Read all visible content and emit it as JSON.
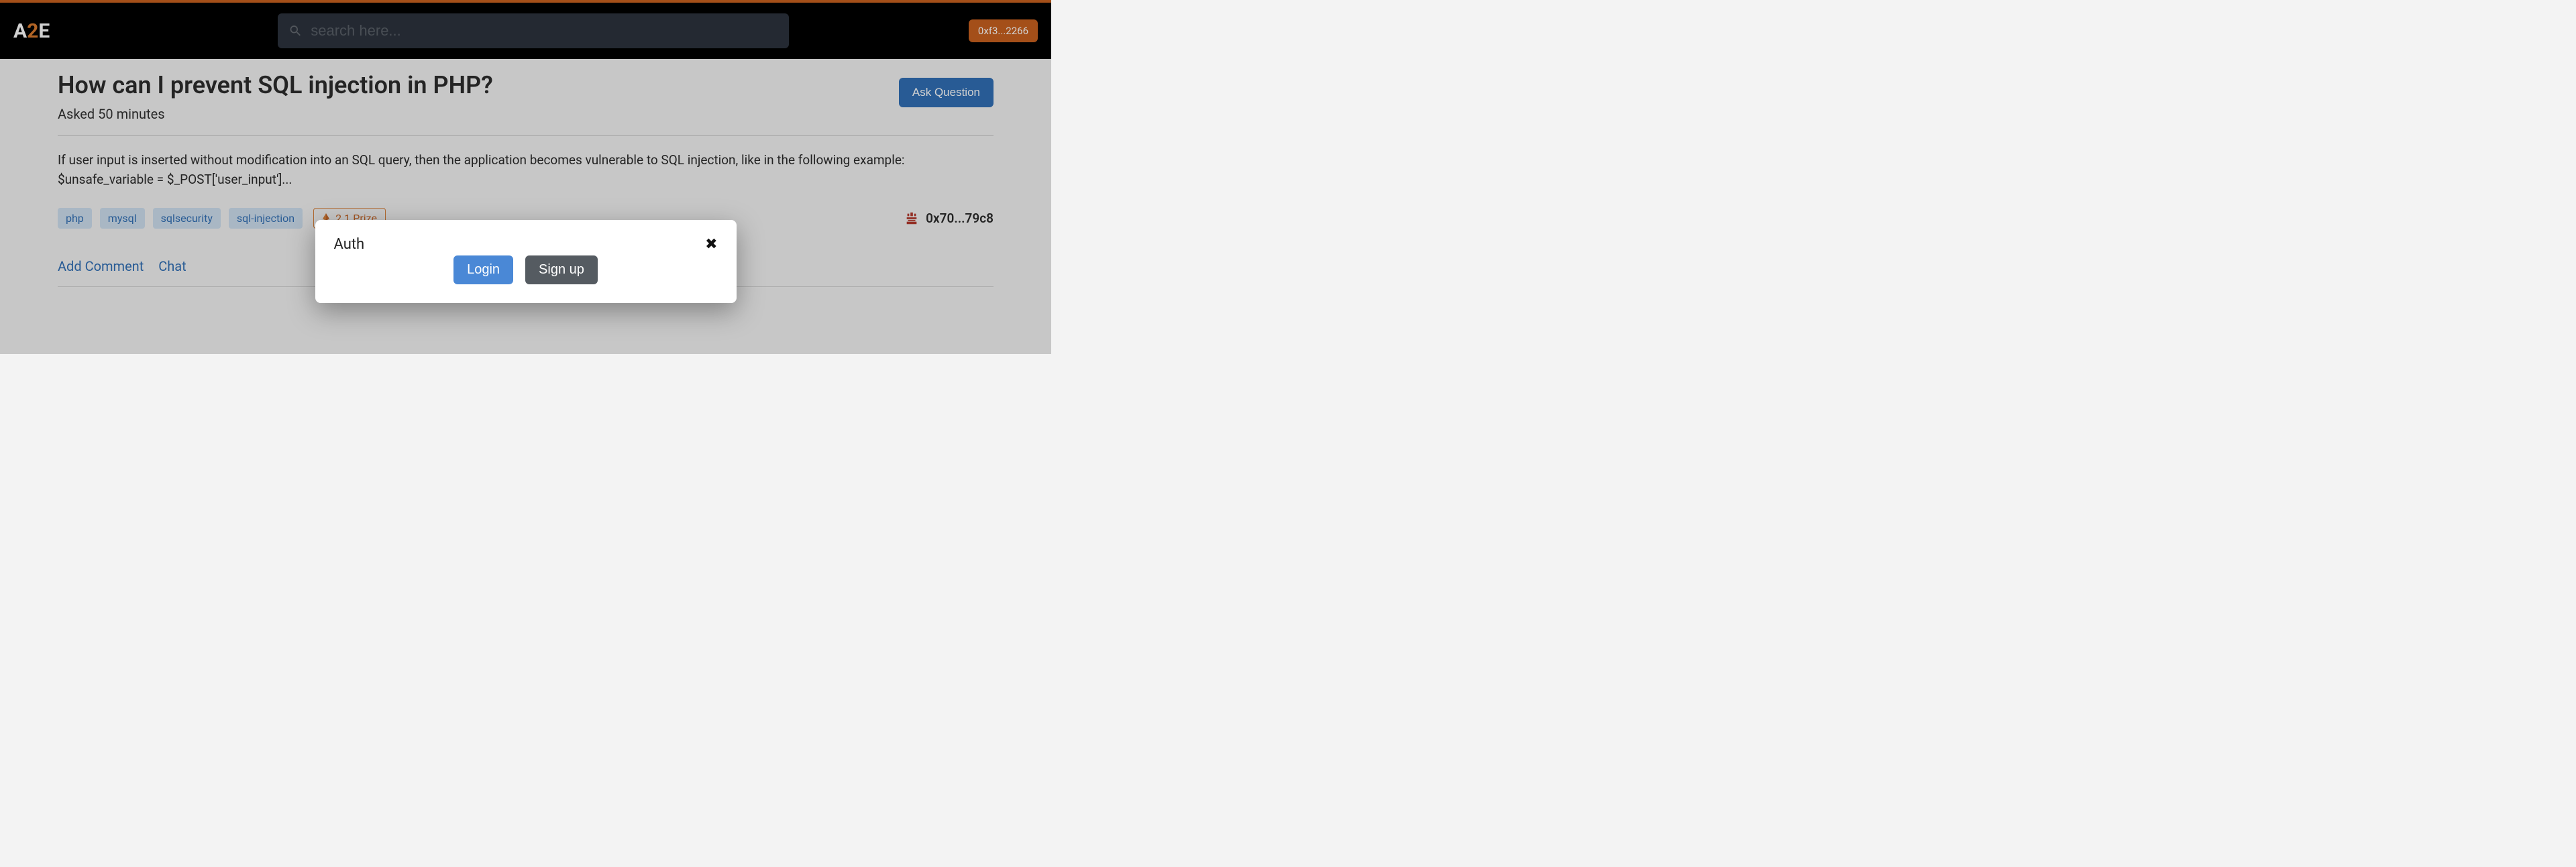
{
  "brand": {
    "a": "A",
    "num": "2",
    "e": "E"
  },
  "search": {
    "placeholder": "search here..."
  },
  "wallet": {
    "short": "0xf3...2266"
  },
  "question": {
    "title": "How can I prevent SQL injection in PHP?",
    "asked": "Asked 50 minutes",
    "body": "If user input is inserted without modification into an SQL query, then the application becomes vulnerable to SQL injection, like in the following example: $unsafe_variable = $_POST['user_input']...",
    "author": "0x70...79c8"
  },
  "ask_button": "Ask Question",
  "tags": [
    "php",
    "mysql",
    "sqlsecurity",
    "sql-injection"
  ],
  "prize": {
    "label": "2.1 Prize"
  },
  "actions": {
    "add_comment": "Add Comment",
    "chat": "Chat"
  },
  "modal": {
    "title": "Auth",
    "login": "Login",
    "signup": "Sign up"
  }
}
